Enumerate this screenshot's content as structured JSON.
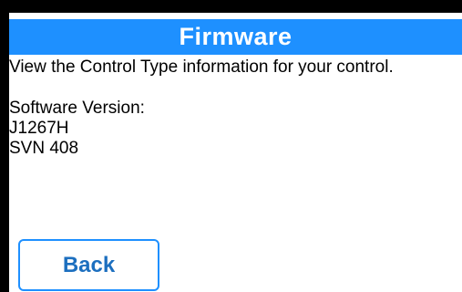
{
  "header": {
    "title": "Firmware"
  },
  "main": {
    "description": "View the Control Type information for your control.",
    "software_version_label": "Software Version:",
    "software_code": "J1267H",
    "svn": "SVN 408"
  },
  "footer": {
    "back_label": "Back"
  },
  "colors": {
    "accent": "#1e90ff",
    "background": "#ffffff",
    "frame": "#000000"
  }
}
